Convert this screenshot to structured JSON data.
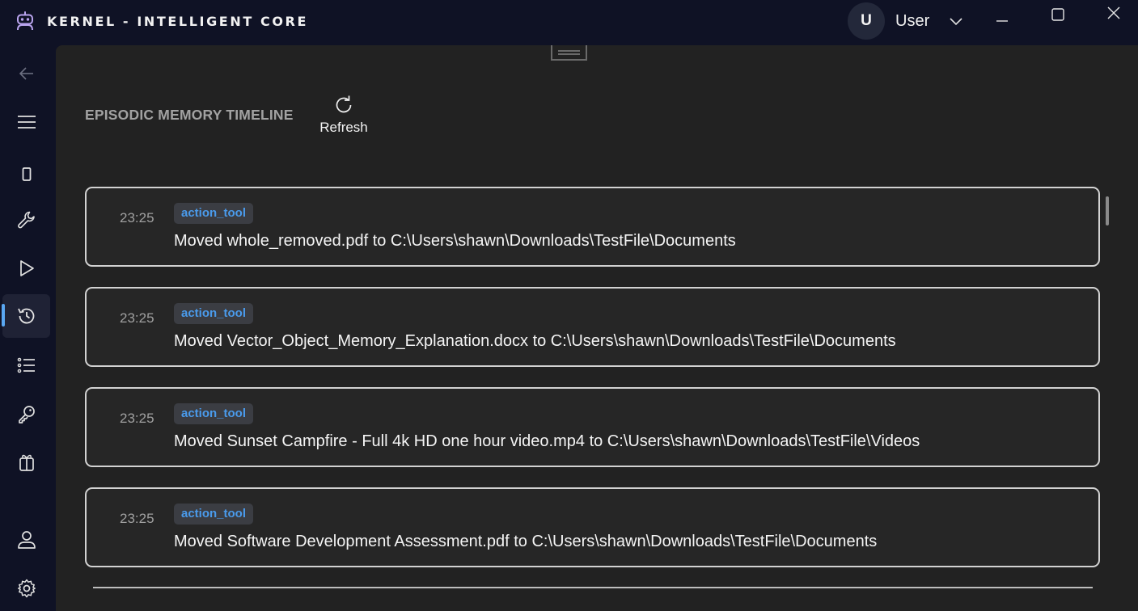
{
  "app": {
    "title": "KERNEL - INTELLIGENT CORE"
  },
  "user": {
    "initial": "U",
    "name": "User"
  },
  "nav": {
    "items": [
      {
        "icon": "back-arrow-icon"
      },
      {
        "icon": "hamburger-menu-icon"
      },
      {
        "icon": "phone-icon"
      },
      {
        "icon": "wrench-icon"
      },
      {
        "icon": "play-icon"
      },
      {
        "icon": "history-icon",
        "active": true
      },
      {
        "icon": "checklist-icon"
      },
      {
        "icon": "key-icon"
      },
      {
        "icon": "gift-icon"
      },
      {
        "icon": "user-icon"
      },
      {
        "icon": "settings-gear-icon"
      }
    ]
  },
  "page": {
    "title": "EPISODIC MEMORY TIMELINE",
    "refresh_label": "Refresh"
  },
  "memories": [
    {
      "time": "23:25",
      "tag": "action_tool",
      "text": "Moved whole_removed.pdf to C:\\Users\\shawn\\Downloads\\TestFile\\Documents"
    },
    {
      "time": "23:25",
      "tag": "action_tool",
      "text": "Moved Vector_Object_Memory_Explanation.docx to C:\\Users\\shawn\\Downloads\\TestFile\\Documents"
    },
    {
      "time": "23:25",
      "tag": "action_tool",
      "text": "Moved Sunset Campfire - Full 4k HD one hour video.mp4 to C:\\Users\\shawn\\Downloads\\TestFile\\Videos"
    },
    {
      "time": "23:25",
      "tag": "action_tool",
      "text": "Moved Software Development Assessment.pdf to C:\\Users\\shawn\\Downloads\\TestFile\\Documents"
    }
  ],
  "colors": {
    "accent": "#5aa7f2",
    "tag_text": "#4a9bec",
    "tag_bg": "#3b3d43",
    "window_bg": "#0f1225",
    "content_bg": "#222222"
  }
}
